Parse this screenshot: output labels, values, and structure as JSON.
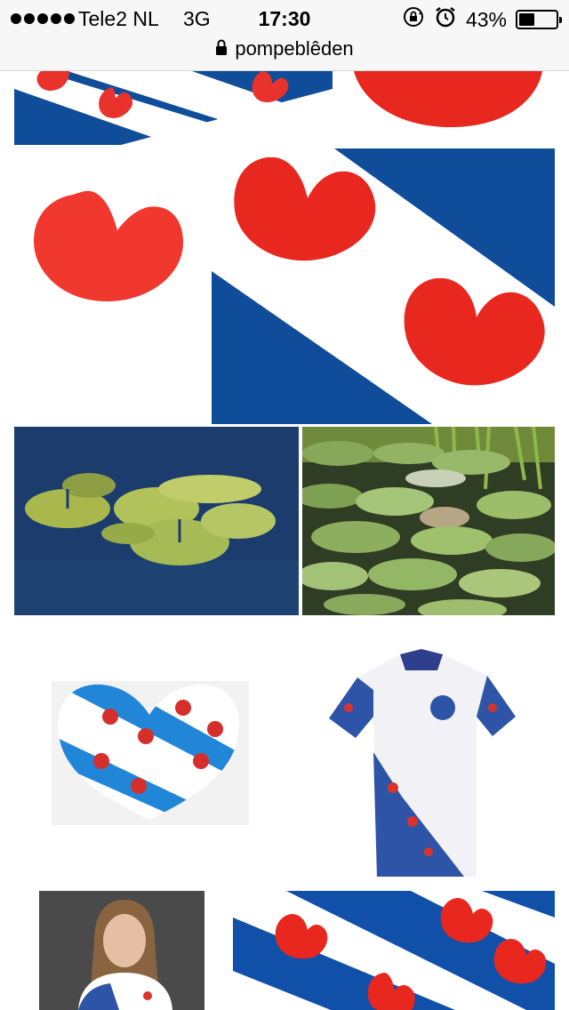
{
  "status_bar": {
    "carrier": "Tele2 NL",
    "network": "3G",
    "time": "17:30",
    "battery_percent": "43%",
    "battery_level": 0.43,
    "icons": [
      "rotation-lock-icon",
      "alarm-icon"
    ]
  },
  "browser": {
    "url": "pompeblêden",
    "secure": true
  },
  "colors": {
    "frisian_blue": "#0f4c9a",
    "frisian_red": "#e8322b",
    "water_blue": "#1b3c6c",
    "leaf_green": "#a9c25e"
  },
  "image_results": [
    {
      "subject": "frisian-flag"
    },
    {
      "subject": "red-pompeblad"
    },
    {
      "subject": "red-pompeblad"
    },
    {
      "subject": "frisian-flag"
    },
    {
      "subject": "water-lily-leaves"
    },
    {
      "subject": "water-lily-pond"
    },
    {
      "subject": "frisian-heart"
    },
    {
      "subject": "frisian-cycling-jersey"
    },
    {
      "subject": "person-in-frisian-jersey"
    },
    {
      "subject": "frisian-flag"
    }
  ]
}
